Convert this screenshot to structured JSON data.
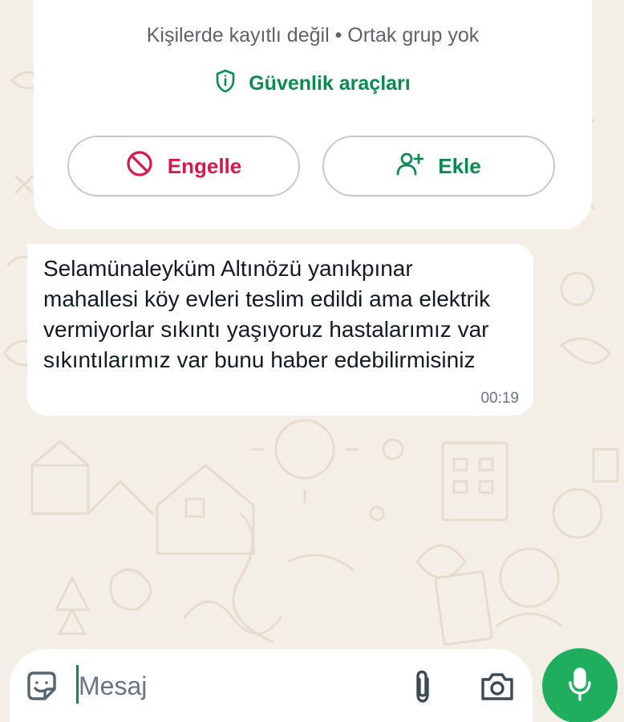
{
  "contact_info": {
    "subtitle": "Kişilerde kayıtlı değil • Ortak grup yok",
    "safety_tools_label": "Güvenlik araçları",
    "safety_icon": "shield-info-icon",
    "block_label": "Engelle",
    "block_icon": "block-icon",
    "add_label": "Ekle",
    "add_icon": "add-contact-icon"
  },
  "message": {
    "text": "Selamünaleyküm Altınözü yanıkpınar mahallesi köy evleri teslim edildi ama elektrik vermiyorlar sıkıntı yaşıyoruz hastalarımız var sıkıntılarımız var bunu haber edebilirmisiniz",
    "time": "00:19"
  },
  "composer": {
    "placeholder": "Mesaj",
    "emoji_icon": "sticker-icon",
    "attach_icon": "paperclip-icon",
    "camera_icon": "camera-icon",
    "mic_icon": "mic-icon"
  },
  "colors": {
    "accent_green": "#0b8a4f",
    "mic_green": "#1eae5e",
    "danger_red": "#d5194a",
    "wallpaper": "#f4efe6"
  }
}
